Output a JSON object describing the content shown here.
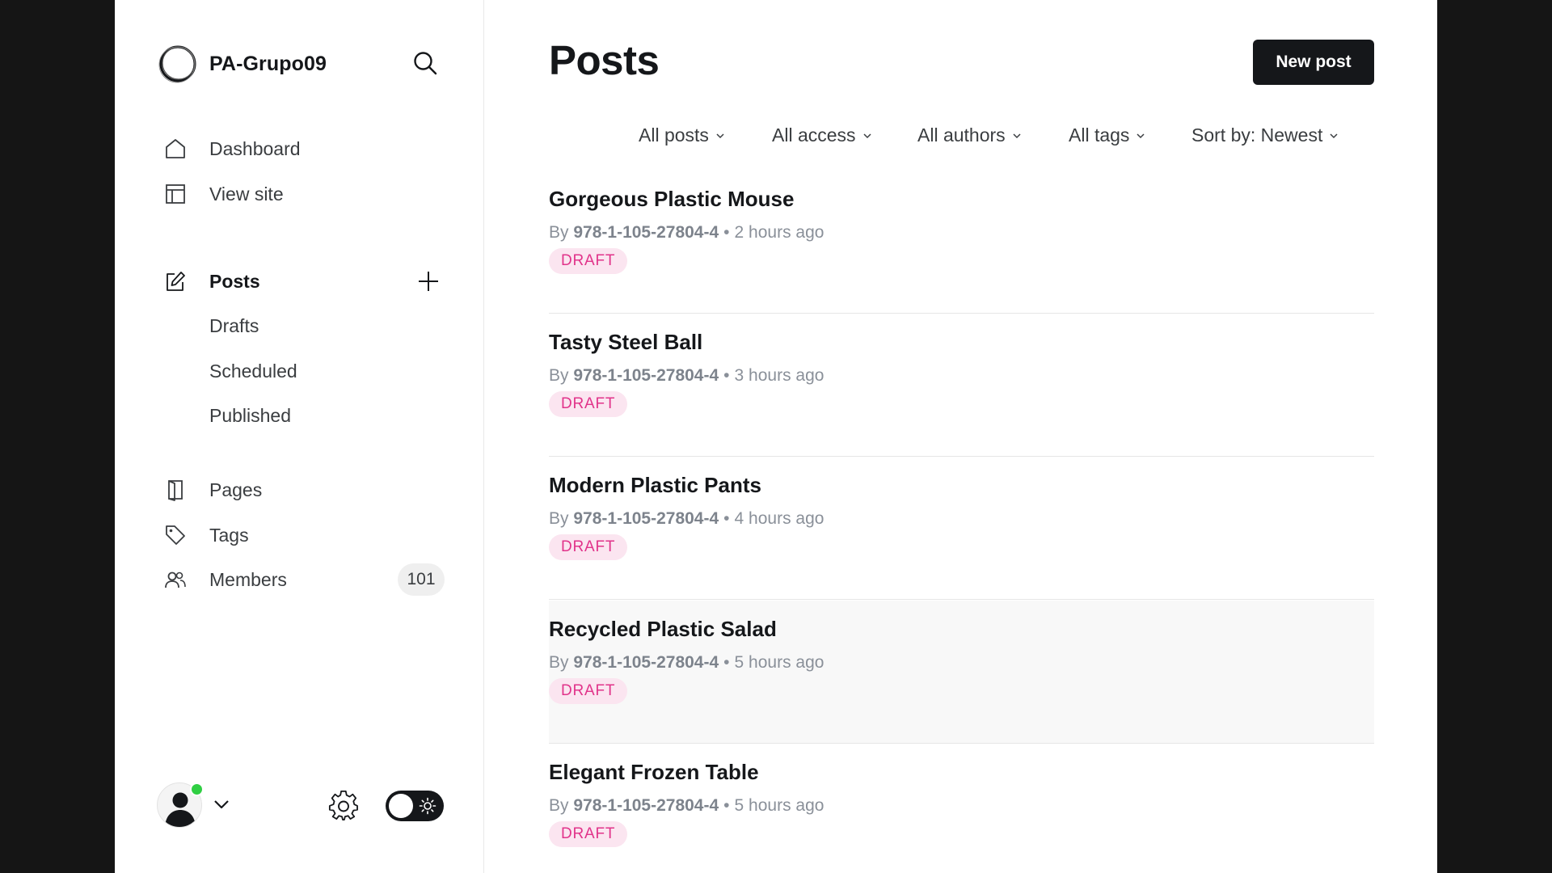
{
  "brand": {
    "name": "PA-Grupo09",
    "logo_icon": "circle-logo-icon"
  },
  "nav": {
    "dashboard": "Dashboard",
    "view_site": "View site",
    "posts": "Posts",
    "drafts": "Drafts",
    "scheduled": "Scheduled",
    "published": "Published",
    "pages": "Pages",
    "tags": "Tags",
    "members": "Members",
    "members_count": "101"
  },
  "header": {
    "title": "Posts",
    "new_post_label": "New post"
  },
  "filters": {
    "type": "All posts",
    "access": "All access",
    "authors": "All authors",
    "tags": "All tags",
    "sort": "Sort by: Newest"
  },
  "posts": [
    {
      "title": "Gorgeous Plastic Mouse",
      "by": "By",
      "author": "978-1-105-27804-4",
      "time": "2 hours ago",
      "status": "DRAFT"
    },
    {
      "title": "Tasty Steel Ball",
      "by": "By",
      "author": "978-1-105-27804-4",
      "time": "3 hours ago",
      "status": "DRAFT"
    },
    {
      "title": "Modern Plastic Pants",
      "by": "By",
      "author": "978-1-105-27804-4",
      "time": "4 hours ago",
      "status": "DRAFT"
    },
    {
      "title": "Recycled Plastic Salad",
      "by": "By",
      "author": "978-1-105-27804-4",
      "time": "5 hours ago",
      "status": "DRAFT"
    },
    {
      "title": "Elegant Frozen Table",
      "by": "By",
      "author": "978-1-105-27804-4",
      "time": "5 hours ago",
      "status": "DRAFT"
    }
  ],
  "colors": {
    "accent_dark": "#15171a",
    "draft_bg": "#fbe5f0",
    "draft_text": "#e1338a",
    "online": "#30cf43"
  }
}
